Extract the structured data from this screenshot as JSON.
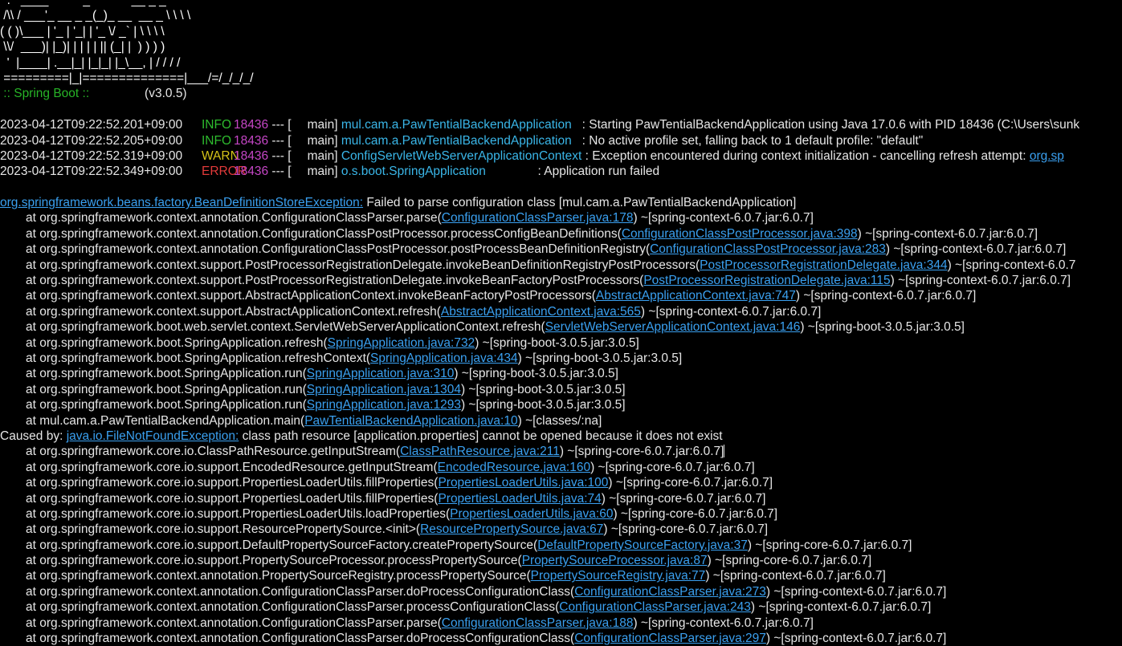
{
  "banner": {
    "lines": [
      "  .   ____          _            __ _ _",
      " /\\\\ / ___'_ __ _ _(_)_ __  __ _ \\ \\ \\ \\",
      "( ( )\\___ | '_ | '_| | '_ \\/ _` | \\ \\ \\ \\",
      " \\\\/  ___)| |_)| | | | | || (_| |  ) ) ) )",
      "  '  |____| .__|_| |_|_| |_\\__, | / / / /",
      " =========|_|==============|___/=/_/_/_/"
    ],
    "boot_label": " :: Spring Boot :: ",
    "boot_version": "               (v3.0.5)"
  },
  "log": [
    {
      "timestamp": "2023-04-12T09:22:52.201+09:00",
      "level": "INFO",
      "pid": "18436",
      "sep": " --- [",
      "thread": "main]",
      "logger": "mul.cam.a.PawTentialBackendApplication",
      "message": "   : Starting PawTentialBackendApplication using Java 17.0.6 with PID 18436 (C:\\Users\\sunk",
      "message_link": ""
    },
    {
      "timestamp": "2023-04-12T09:22:52.205+09:00",
      "level": "INFO",
      "pid": "18436",
      "sep": " --- [",
      "thread": "main]",
      "logger": "mul.cam.a.PawTentialBackendApplication",
      "message": "   : No active profile set, falling back to 1 default profile: \"default\"",
      "message_link": ""
    },
    {
      "timestamp": "2023-04-12T09:22:52.319+09:00",
      "level": "WARN",
      "pid": "18436",
      "sep": " --- [",
      "thread": "main]",
      "logger": "ConfigServletWebServerApplicationContext",
      "message": " : Exception encountered during context initialization - cancelling refresh attempt: ",
      "message_link": "org.sp"
    },
    {
      "timestamp": "2023-04-12T09:22:52.349+09:00",
      "level": "ERROR",
      "pid": "18436",
      "sep": " --- [",
      "thread": "main]",
      "logger": "o.s.boot.SpringApplication",
      "message": "               : Application run failed",
      "message_link": ""
    }
  ],
  "exception": {
    "name": "org.springframework.beans.factory.BeanDefinitionStoreException:",
    "message": " Failed to parse configuration class [mul.cam.a.PawTentialBackendApplication]"
  },
  "stack": [
    {
      "prefix": "at org.springframework.context.annotation.ConfigurationClassParser.parse(",
      "link": "ConfigurationClassParser.java:178",
      "suffix": ") ~[spring-context-6.0.7.jar:6.0.7]"
    },
    {
      "prefix": "at org.springframework.context.annotation.ConfigurationClassPostProcessor.processConfigBeanDefinitions(",
      "link": "ConfigurationClassPostProcessor.java:398",
      "suffix": ") ~[spring-context-6.0.7.jar:6.0.7]"
    },
    {
      "prefix": "at org.springframework.context.annotation.ConfigurationClassPostProcessor.postProcessBeanDefinitionRegistry(",
      "link": "ConfigurationClassPostProcessor.java:283",
      "suffix": ") ~[spring-context-6.0.7.jar:6.0.7]"
    },
    {
      "prefix": "at org.springframework.context.support.PostProcessorRegistrationDelegate.invokeBeanDefinitionRegistryPostProcessors(",
      "link": "PostProcessorRegistrationDelegate.java:344",
      "suffix": ") ~[spring-context-6.0.7"
    },
    {
      "prefix": "at org.springframework.context.support.PostProcessorRegistrationDelegate.invokeBeanFactoryPostProcessors(",
      "link": "PostProcessorRegistrationDelegate.java:115",
      "suffix": ") ~[spring-context-6.0.7.jar:6.0.7]"
    },
    {
      "prefix": "at org.springframework.context.support.AbstractApplicationContext.invokeBeanFactoryPostProcessors(",
      "link": "AbstractApplicationContext.java:747",
      "suffix": ") ~[spring-context-6.0.7.jar:6.0.7]"
    },
    {
      "prefix": "at org.springframework.context.support.AbstractApplicationContext.refresh(",
      "link": "AbstractApplicationContext.java:565",
      "suffix": ") ~[spring-context-6.0.7.jar:6.0.7]"
    },
    {
      "prefix": "at org.springframework.boot.web.servlet.context.ServletWebServerApplicationContext.refresh(",
      "link": "ServletWebServerApplicationContext.java:146",
      "suffix": ") ~[spring-boot-3.0.5.jar:3.0.5]"
    },
    {
      "prefix": "at org.springframework.boot.SpringApplication.refresh(",
      "link": "SpringApplication.java:732",
      "suffix": ") ~[spring-boot-3.0.5.jar:3.0.5]"
    },
    {
      "prefix": "at org.springframework.boot.SpringApplication.refreshContext(",
      "link": "SpringApplication.java:434",
      "suffix": ") ~[spring-boot-3.0.5.jar:3.0.5]"
    },
    {
      "prefix": "at org.springframework.boot.SpringApplication.run(",
      "link": "SpringApplication.java:310",
      "suffix": ") ~[spring-boot-3.0.5.jar:3.0.5]"
    },
    {
      "prefix": "at org.springframework.boot.SpringApplication.run(",
      "link": "SpringApplication.java:1304",
      "suffix": ") ~[spring-boot-3.0.5.jar:3.0.5]"
    },
    {
      "prefix": "at org.springframework.boot.SpringApplication.run(",
      "link": "SpringApplication.java:1293",
      "suffix": ") ~[spring-boot-3.0.5.jar:3.0.5]"
    },
    {
      "prefix": "at mul.cam.a.PawTentialBackendApplication.main(",
      "link": "PawTentialBackendApplication.java:10",
      "suffix": ") ~[classes/:na]"
    }
  ],
  "cause": {
    "label": "Caused by: ",
    "name": "java.io.FileNotFoundException:",
    "message": " class path resource [application.properties] cannot be opened because it does not exist"
  },
  "cause_stack": [
    {
      "prefix": "at org.springframework.core.io.ClassPathResource.getInputStream(",
      "link": "ClassPathResource.java:211",
      "suffix": ") ~[spring-core-6.0.7.jar:6.0.7]"
    },
    {
      "prefix": "at org.springframework.core.io.support.EncodedResource.getInputStream(",
      "link": "EncodedResource.java:160",
      "suffix": ") ~[spring-core-6.0.7.jar:6.0.7]"
    },
    {
      "prefix": "at org.springframework.core.io.support.PropertiesLoaderUtils.fillProperties(",
      "link": "PropertiesLoaderUtils.java:100",
      "suffix": ") ~[spring-core-6.0.7.jar:6.0.7]"
    },
    {
      "prefix": "at org.springframework.core.io.support.PropertiesLoaderUtils.fillProperties(",
      "link": "PropertiesLoaderUtils.java:74",
      "suffix": ") ~[spring-core-6.0.7.jar:6.0.7]"
    },
    {
      "prefix": "at org.springframework.core.io.support.PropertiesLoaderUtils.loadProperties(",
      "link": "PropertiesLoaderUtils.java:60",
      "suffix": ") ~[spring-core-6.0.7.jar:6.0.7]"
    },
    {
      "prefix": "at org.springframework.core.io.support.ResourcePropertySource.<init>(",
      "link": "ResourcePropertySource.java:67",
      "suffix": ") ~[spring-core-6.0.7.jar:6.0.7]"
    },
    {
      "prefix": "at org.springframework.core.io.support.DefaultPropertySourceFactory.createPropertySource(",
      "link": "DefaultPropertySourceFactory.java:37",
      "suffix": ") ~[spring-core-6.0.7.jar:6.0.7]"
    },
    {
      "prefix": "at org.springframework.core.io.support.PropertySourceProcessor.processPropertySource(",
      "link": "PropertySourceProcessor.java:87",
      "suffix": ") ~[spring-core-6.0.7.jar:6.0.7]"
    },
    {
      "prefix": "at org.springframework.context.annotation.PropertySourceRegistry.processPropertySource(",
      "link": "PropertySourceRegistry.java:77",
      "suffix": ") ~[spring-context-6.0.7.jar:6.0.7]"
    },
    {
      "prefix": "at org.springframework.context.annotation.ConfigurationClassParser.doProcessConfigurationClass(",
      "link": "ConfigurationClassParser.java:273",
      "suffix": ") ~[spring-context-6.0.7.jar:6.0.7]"
    },
    {
      "prefix": "at org.springframework.context.annotation.ConfigurationClassParser.processConfigurationClass(",
      "link": "ConfigurationClassParser.java:243",
      "suffix": ") ~[spring-context-6.0.7.jar:6.0.7]"
    },
    {
      "prefix": "at org.springframework.context.annotation.ConfigurationClassParser.parse(",
      "link": "ConfigurationClassParser.java:188",
      "suffix": ") ~[spring-context-6.0.7.jar:6.0.7]"
    },
    {
      "prefix": "at org.springframework.context.annotation.ConfigurationClassParser.doProcessConfigurationClass(",
      "link": "ConfigurationClassParser.java:297",
      "suffix": ") ~[spring-context-6.0.7.jar:6.0.7]"
    }
  ],
  "caret_row_index": 0,
  "colors": {
    "background": "#000000",
    "text": "#e6e6e6",
    "link": "#3aa0f0",
    "info": "#2ebc2e",
    "warn": "#d6c419",
    "error": "#e23a3a",
    "pid": "#c546c6",
    "logger": "#3ab6e8",
    "boot_label": "#27b427"
  }
}
